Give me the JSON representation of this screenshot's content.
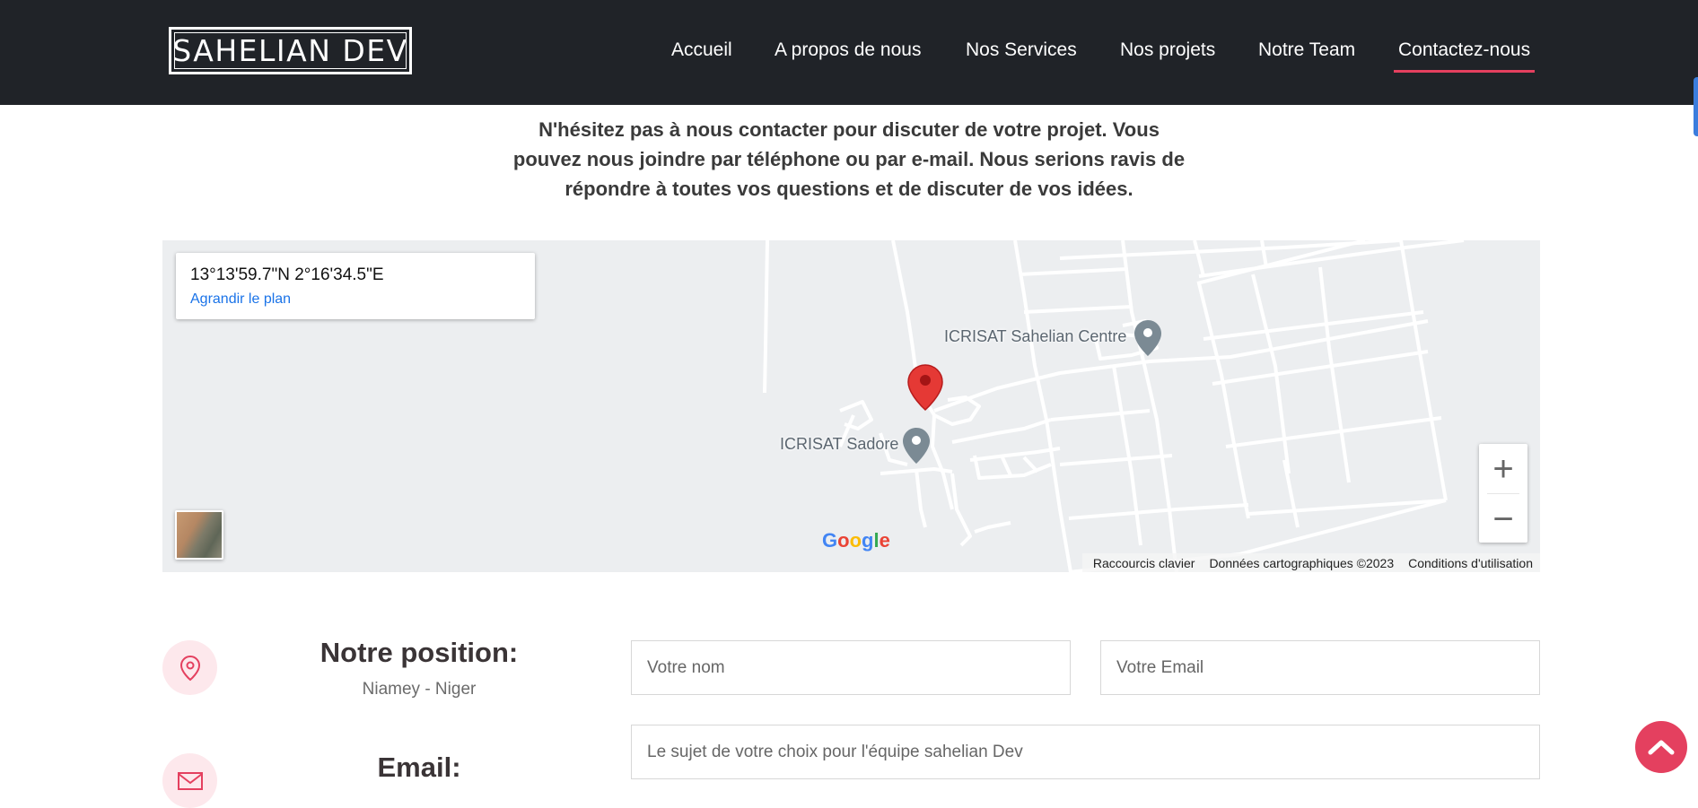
{
  "brand": {
    "logo_text": "SAHELIAN DEV"
  },
  "nav": {
    "items": [
      {
        "label": "Accueil"
      },
      {
        "label": "A propos de nous"
      },
      {
        "label": "Nos Services"
      },
      {
        "label": "Nos projets"
      },
      {
        "label": "Notre Team"
      },
      {
        "label": "Contactez-nous",
        "active": true
      }
    ]
  },
  "intro": {
    "text": "N'hésitez pas à nous contacter pour discuter de votre projet. Vous pouvez nous joindre par téléphone ou par e-mail. Nous serions ravis de répondre à toutes vos questions et de discuter de vos idées."
  },
  "map": {
    "coordinates": "13°13'59.7\"N 2°16'34.5\"E",
    "enlarge_link": "Agrandir le plan",
    "poi_1": "ICRISAT Sahelian Centre",
    "poi_2": "ICRISAT Sadore",
    "zoom_in": "+",
    "zoom_out": "−",
    "footer": {
      "shortcuts": "Raccourcis clavier",
      "data": "Données cartographiques ©2023",
      "terms": "Conditions d'utilisation"
    }
  },
  "contact": {
    "position_title": "Notre position:",
    "position_value": "Niamey - Niger",
    "email_title": "Email:"
  },
  "form": {
    "name_placeholder": "Votre nom",
    "email_placeholder": "Votre Email",
    "subject_placeholder": "Le sujet de votre choix pour l'équipe sahelian Dev"
  },
  "colors": {
    "header_bg": "#202328",
    "accent": "#e4405f",
    "link": "#1a73e8"
  },
  "icons": [
    "map-pin-icon",
    "envelope-icon",
    "chevron-up-icon",
    "map-marker-icon",
    "poi-pin-icon"
  ]
}
